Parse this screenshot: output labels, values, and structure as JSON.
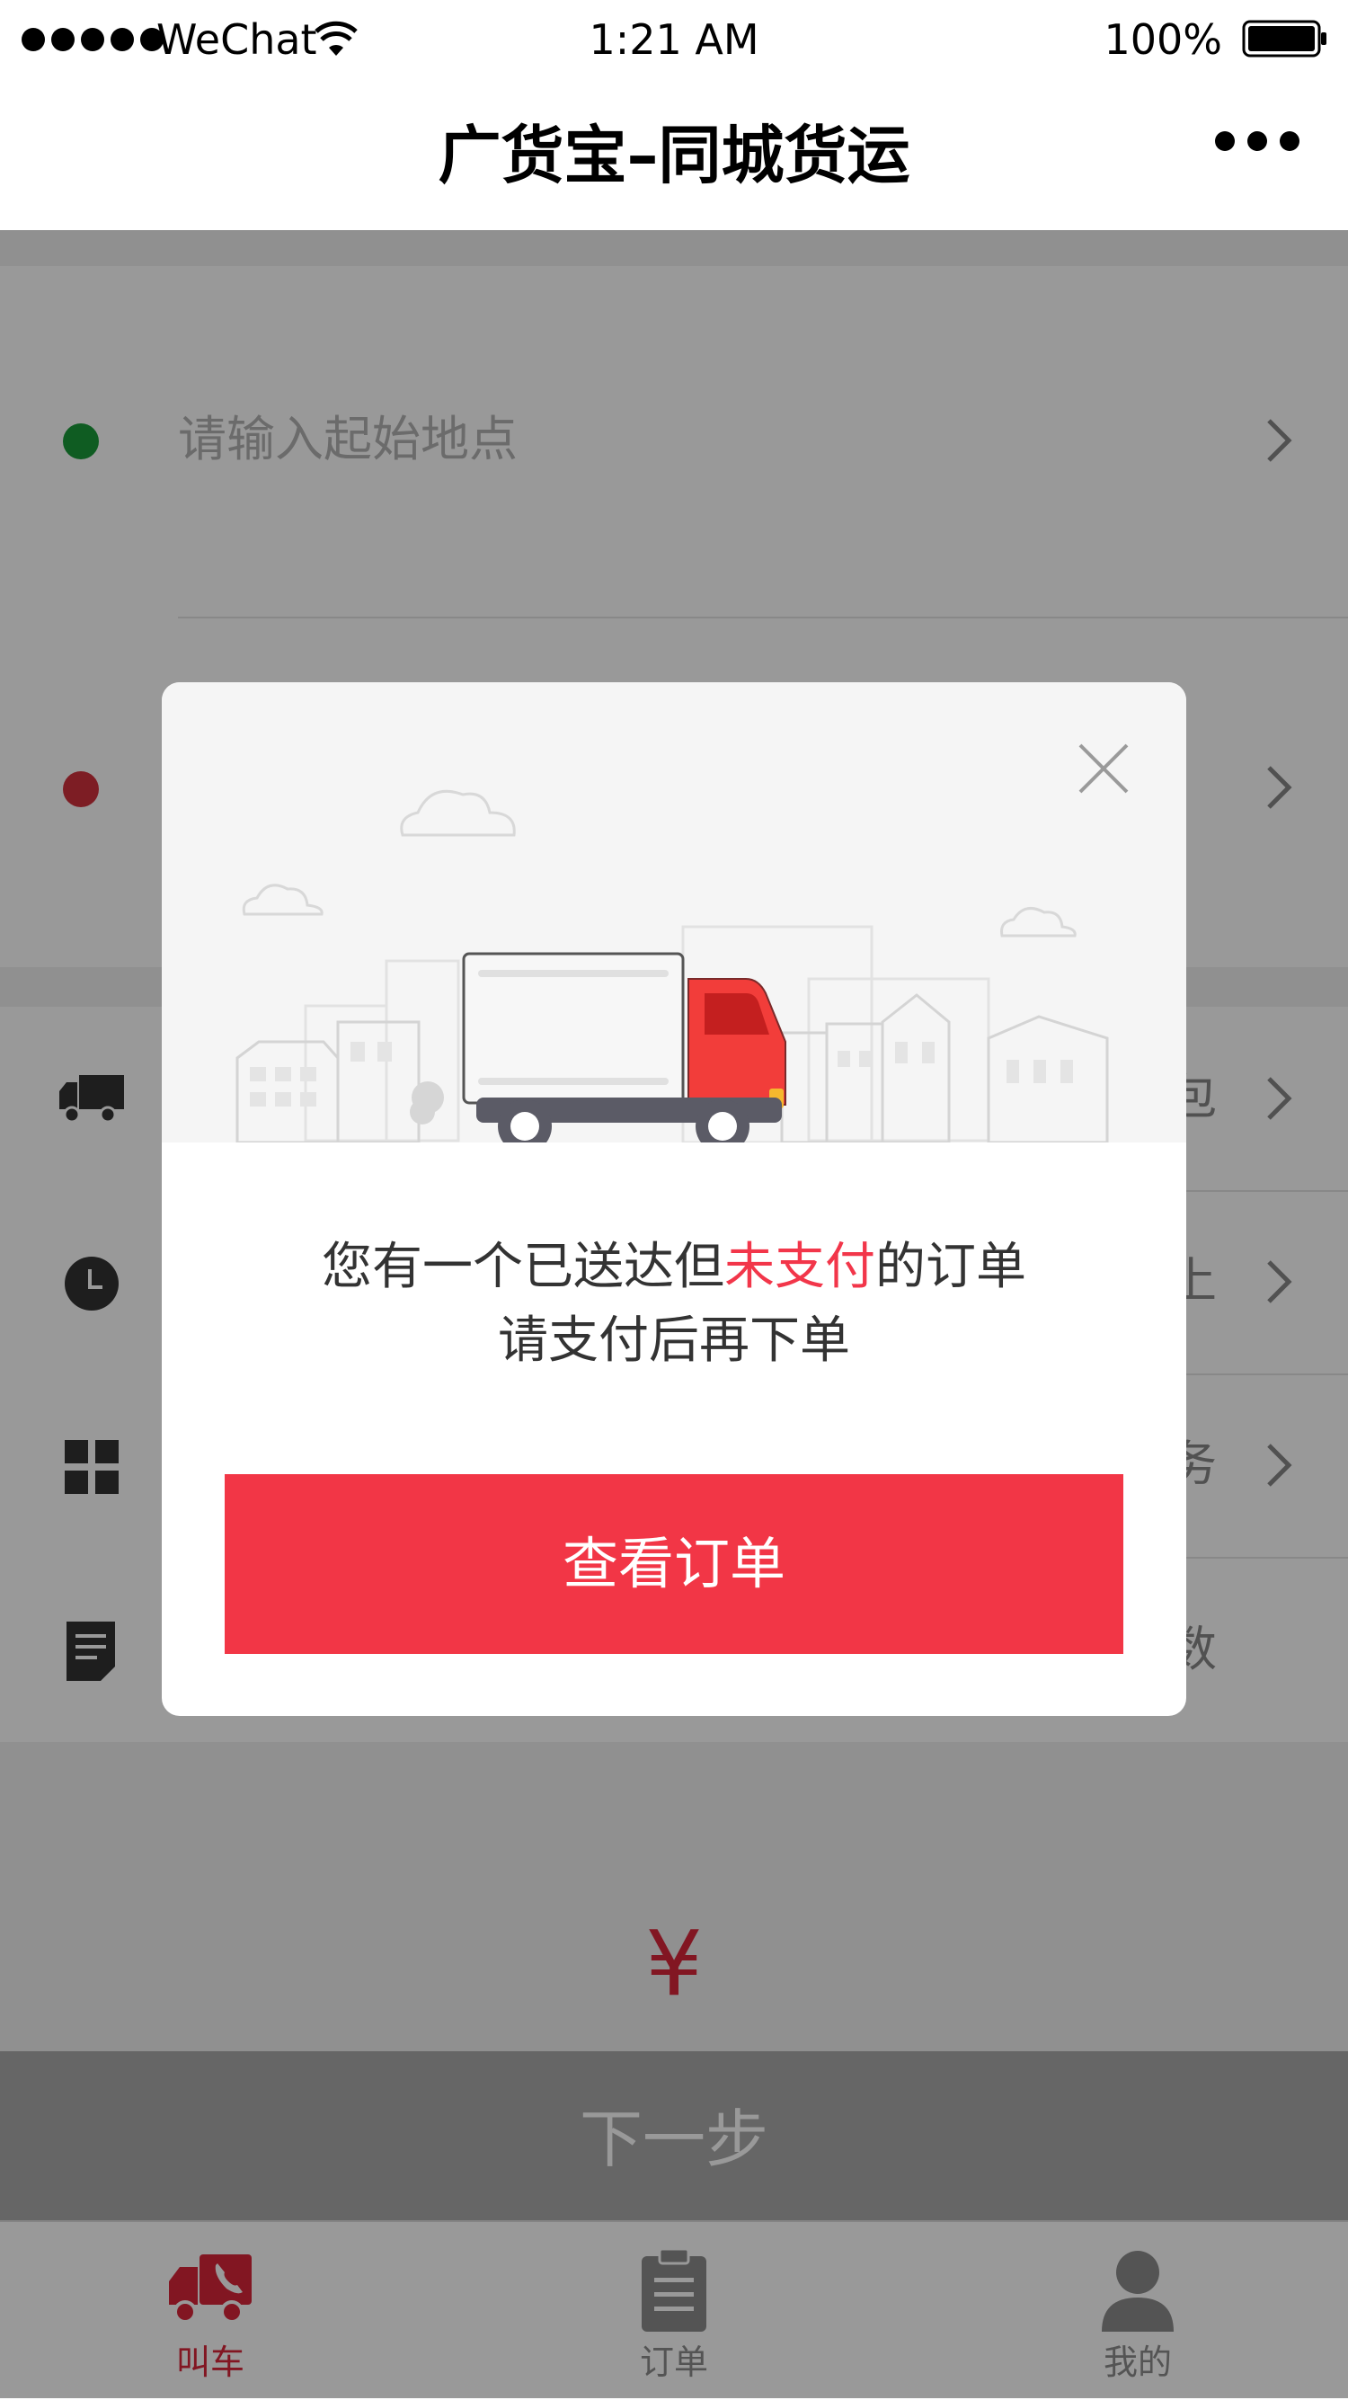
{
  "status_bar": {
    "carrier": "WeChat",
    "time": "1:21 AM",
    "battery": "100%",
    "icons": [
      "signal-dots-icon",
      "wifi-icon",
      "battery-icon"
    ]
  },
  "nav": {
    "title": "广货宝–同城货运",
    "more_icon": "more-dots-icon"
  },
  "form": {
    "start_placeholder": "请输入起始地点",
    "start_dot_color": "#1a9a3a",
    "end_dot_color": "#d0313c",
    "option_rows": [
      {
        "icon": "truck-icon",
        "trail": "包"
      },
      {
        "icon": "clock-icon",
        "trail": "上"
      },
      {
        "icon": "grid-icon",
        "trail": "务"
      },
      {
        "icon": "document-icon",
        "trail": "数"
      }
    ]
  },
  "price": {
    "currency_symbol": "¥"
  },
  "next_button": {
    "label": "下一步"
  },
  "tab_bar": {
    "tabs": [
      {
        "label": "叫车",
        "icon": "call-truck-icon",
        "active": true
      },
      {
        "label": "订单",
        "icon": "clipboard-icon",
        "active": false
      },
      {
        "label": "我的",
        "icon": "person-icon",
        "active": false
      }
    ],
    "active_color": "#d9253a",
    "inactive_color": "#8c8c8c"
  },
  "modal": {
    "message_line1_before": "您有一个已送达但",
    "message_line1_highlight": "未支付",
    "message_line1_after": "的订单",
    "message_line2": "请支付后再下单",
    "button_label": "查看订单",
    "illustration": "delivery-truck-city-illustration",
    "accent_color": "#f23646"
  }
}
